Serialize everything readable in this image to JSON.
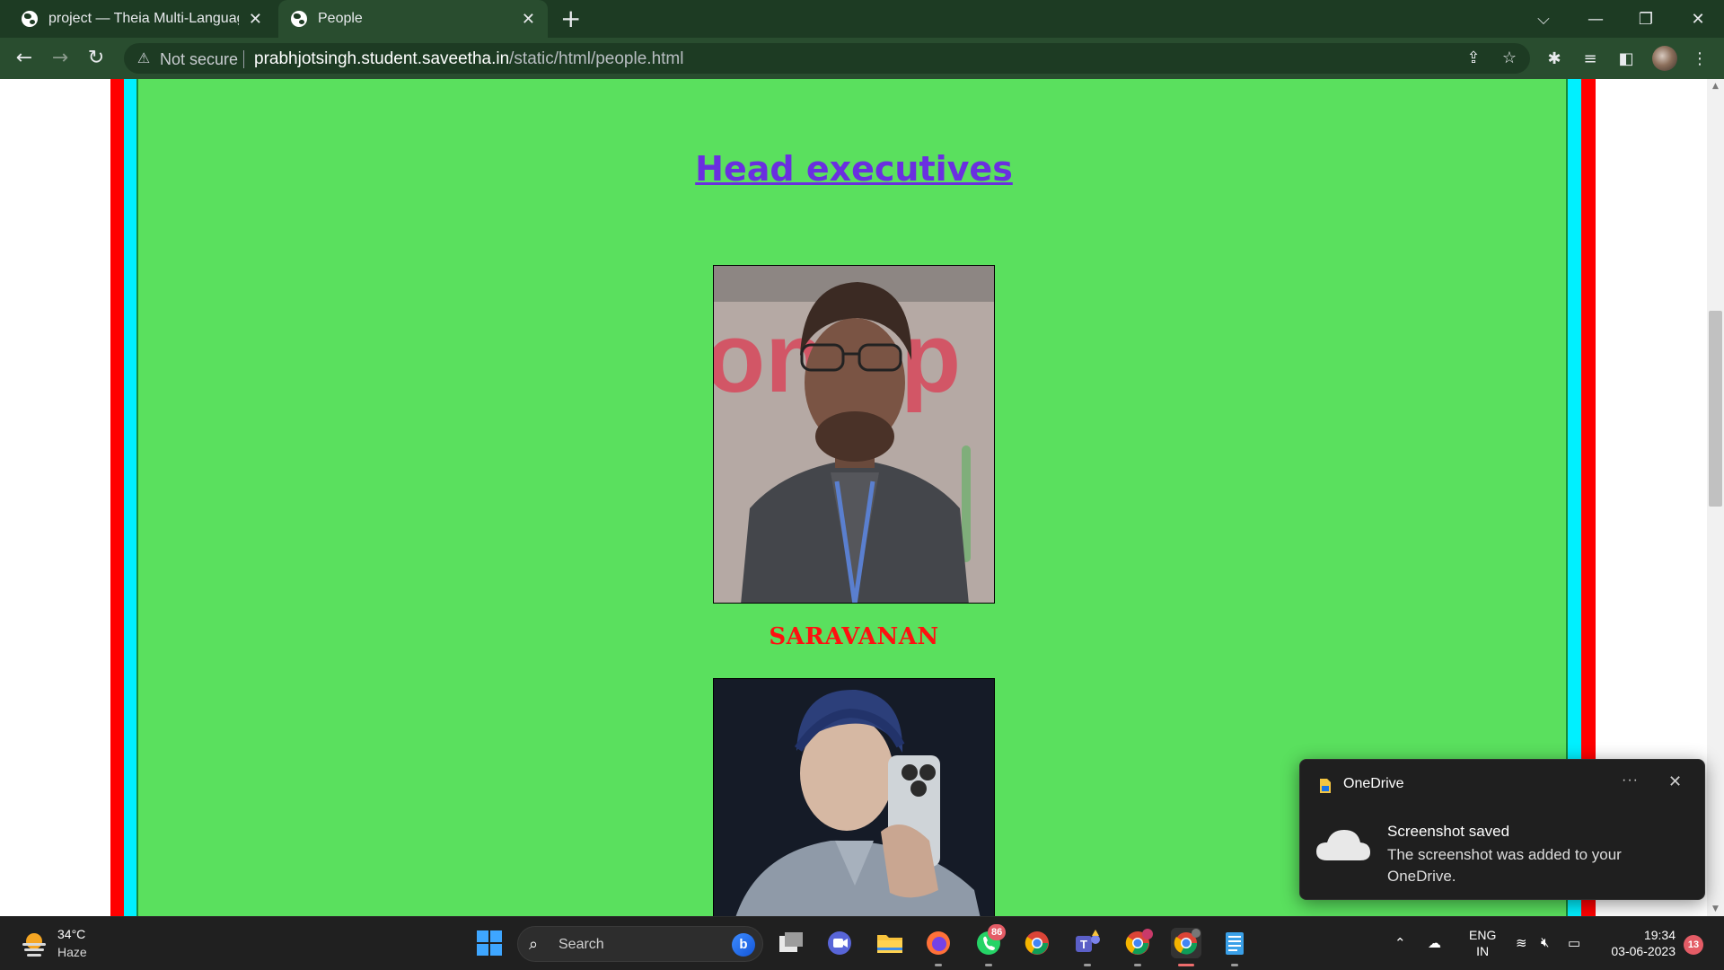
{
  "browser": {
    "tabs": [
      {
        "title": "project — Theia Multi-Language",
        "active": false
      },
      {
        "title": "People",
        "active": true
      }
    ],
    "address": {
      "security_label": "Not secure",
      "host": "prabhjotsingh.student.saveetha.in",
      "path": "/static/html/people.html"
    }
  },
  "page": {
    "heading": "Head executives",
    "people": [
      {
        "name": "SARAVANAN",
        "photo": "person-photo-glasses-lanyard"
      },
      {
        "photo": "person-photo-turban-selfie"
      }
    ],
    "colors": {
      "background": "#5ae05e",
      "border_red": "#ff0000",
      "border_cyan": "#00f0ff",
      "heading": "#6a2fe0",
      "name": "#ff1010"
    }
  },
  "toast": {
    "app": "OneDrive",
    "title": "Screenshot saved",
    "body": "The screenshot was added to your OneDrive."
  },
  "taskbar": {
    "weather": {
      "temp": "34°C",
      "desc": "Haze"
    },
    "search_label": "Search",
    "whatsapp_badge": "86",
    "lang": {
      "line1": "ENG",
      "line2": "IN"
    },
    "clock": {
      "time": "19:34",
      "date": "03-06-2023"
    },
    "notification_count": "13",
    "apps": [
      "windows-start",
      "search",
      "task-view",
      "meet-now",
      "file-explorer",
      "firefox",
      "whatsapp",
      "chrome",
      "teams",
      "chrome-profile",
      "chrome-active",
      "notepad"
    ]
  }
}
